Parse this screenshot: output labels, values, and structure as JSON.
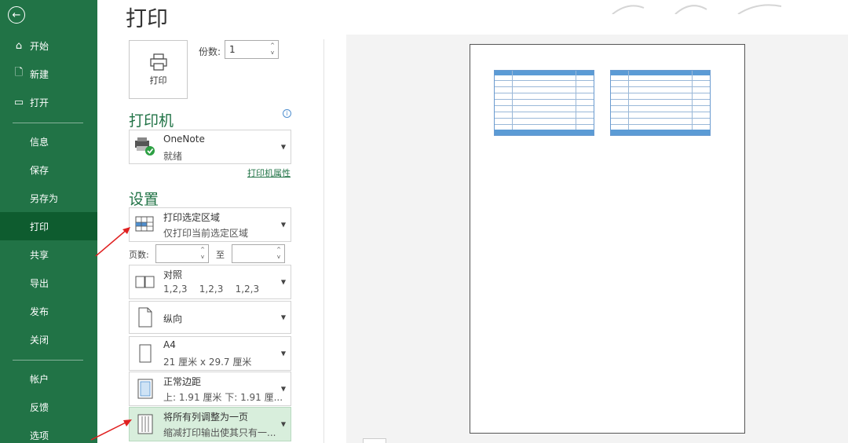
{
  "sidebar": {
    "back_icon": "back-arrow-icon",
    "items": [
      {
        "label": "开始",
        "icon": "home-icon"
      },
      {
        "label": "新建",
        "icon": "new-document-icon"
      },
      {
        "label": "打开",
        "icon": "open-folder-icon"
      },
      {
        "label": "信息"
      },
      {
        "label": "保存"
      },
      {
        "label": "另存为"
      },
      {
        "label": "打印",
        "active": true
      },
      {
        "label": "共享"
      },
      {
        "label": "导出"
      },
      {
        "label": "发布"
      },
      {
        "label": "关闭"
      },
      {
        "label": "帐户"
      },
      {
        "label": "反馈"
      },
      {
        "label": "选项"
      }
    ],
    "bg_color": "#217346",
    "active_color": "#0e5c2f"
  },
  "main": {
    "title": "打印",
    "print_button_label": "打印",
    "copies_label": "份数:",
    "copies_value": "1",
    "printer_section_title": "打印机",
    "printer": {
      "name": "OneNote",
      "status": "就绪"
    },
    "printer_properties_link": "打印机属性",
    "settings_section_title": "设置",
    "settings": {
      "print_area": {
        "main": "打印选定区域",
        "sub": "仅打印当前选定区域"
      },
      "pages_label": "页数:",
      "to_label": "至",
      "collate": {
        "main": "对照",
        "sub": "1,2,3    1,2,3    1,2,3"
      },
      "orientation": {
        "main": "纵向"
      },
      "paper": {
        "main": "A4",
        "sub": "21 厘米 x 29.7 厘米"
      },
      "margins": {
        "main": "正常边距",
        "sub": "上: 1.91 厘米 下: 1.91 厘..."
      },
      "scaling": {
        "main": "将所有列调整为一页",
        "sub": "缩减打印输出使其只有一..."
      }
    }
  },
  "colors": {
    "accent": "#217346",
    "arrow": "#e02020",
    "highlight": "#d8eedc"
  }
}
